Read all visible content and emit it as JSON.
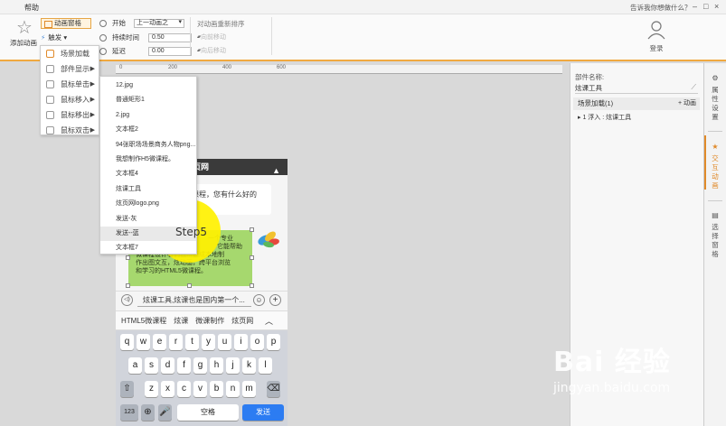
{
  "window": {
    "help_label": "帮助",
    "ask_placeholder": "告诉我你想做什么？",
    "minimize": "–",
    "restore": "□",
    "close": "×"
  },
  "ribbon": {
    "add_animation": "添加动画",
    "animation_pane": "动画窗格",
    "trigger": "触发",
    "start_label": "开始",
    "start_value": "上一动画之",
    "duration_label": "持续时间",
    "duration_value": "0.50",
    "delay_label": "延迟",
    "delay_value": "0.00",
    "reorder_label": "对动画重新排序",
    "move_earlier": "向前移动",
    "move_later": "向后移动",
    "login": "登录"
  },
  "ruler": {
    "ticks": [
      "0",
      "200",
      "400",
      "600"
    ]
  },
  "menu1": {
    "items": [
      {
        "label": "场景加载",
        "has_arrow": false
      },
      {
        "label": "部件显示",
        "has_arrow": true
      },
      {
        "label": "鼠标单击",
        "has_arrow": true
      },
      {
        "label": "鼠标移入",
        "has_arrow": true
      },
      {
        "label": "鼠标移出",
        "has_arrow": true
      },
      {
        "label": "鼠标双击",
        "has_arrow": true
      }
    ]
  },
  "menu2": {
    "items": [
      "12.jpg",
      "普通矩形1",
      "2.jpg",
      "文本框2",
      "94张职场场景商务人物png...",
      "我想制作H5微课程。",
      "文本框4",
      "炫课工具",
      "炫页网logo.png",
      "发送-灰",
      "发送--蓝",
      "文本框7"
    ],
    "highlighted_index": 10
  },
  "step": {
    "label": "Step5"
  },
  "phone": {
    "header_title": "页网",
    "bubble1": "课程，您有什么好的",
    "bubble2_lines": [
      "一个专业",
      "它能帮助",
      "微课程设计者们低…低成本地制",
      "作出图文互，炫动画，跨平台浏览",
      "和学习的HTML5微课程。"
    ],
    "input_text": "炫课工具,炫课也是国内第一个...",
    "suggestions": [
      "HTML5微课程",
      "炫课",
      "微课制作",
      "炫页网"
    ],
    "keyboard": {
      "row1": [
        "q",
        "w",
        "e",
        "r",
        "t",
        "y",
        "u",
        "i",
        "o",
        "p"
      ],
      "row2": [
        "a",
        "s",
        "d",
        "f",
        "g",
        "h",
        "j",
        "k",
        "l"
      ],
      "row3": [
        "z",
        "x",
        "c",
        "v",
        "b",
        "n",
        "m"
      ],
      "num": "123",
      "space": "空格",
      "send": "发送"
    }
  },
  "right_panel": {
    "component_name_label": "部件名称:",
    "component_name_value": "炫课工具",
    "scene_label": "场景加载(1)",
    "add_animation": "+ 动画",
    "anim_row": "1  浮入 : 炫课工具"
  },
  "right_tabs": [
    "属性设置",
    "交互动画",
    "选择窗格"
  ],
  "watermark": {
    "brand": "Bai 经验",
    "url": "jingyan.baidu.com"
  },
  "colors": {
    "accent": "#f0a940",
    "step_circle": "#fff100",
    "send_key": "#2c7cf2",
    "bubble_green": "#a6d86e"
  }
}
